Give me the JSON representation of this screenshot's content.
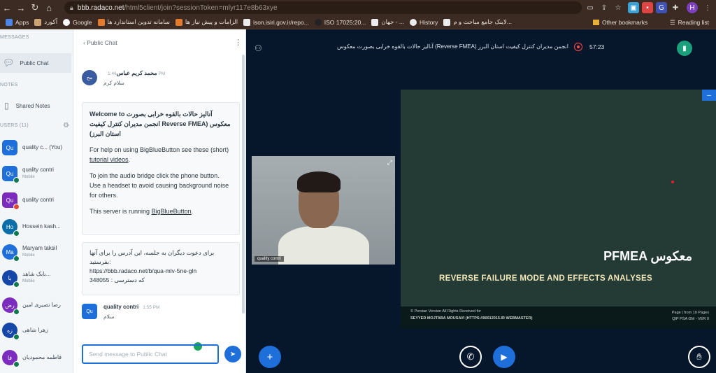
{
  "browser": {
    "url_domain": "bbb.radaco.net",
    "url_rest": "/html5client/join?sessionToken=mlyr117e8b63xye",
    "bookmarks": [
      {
        "label": "Apps",
        "color": "#4a86e8"
      },
      {
        "label": "آکورد",
        "color": "#caa472"
      },
      {
        "label": "Google",
        "color": "#ffffff"
      },
      {
        "label": "سامانه تدوین استاندارد ها",
        "color": "#e37b2e"
      },
      {
        "label": "الزامات و پیش نیاز ها",
        "color": "#e37b2e"
      },
      {
        "label": "ison.isiri.gov.ir/repo...",
        "color": "#ececec"
      },
      {
        "label": "ISO 17025:20...",
        "color": "#ececec"
      },
      {
        "label": "جهان - ...",
        "color": "#ececec"
      },
      {
        "label": "History",
        "color": "#ececec"
      },
      {
        "label": "لاینک جامع مباحث و م...",
        "color": "#ececec"
      }
    ],
    "other_bookmarks": "Other bookmarks",
    "reading_list": "Reading list",
    "profile_initial": "H"
  },
  "sidebar": {
    "messages_heading": "MESSAGES",
    "public_chat": "Public Chat",
    "notes_heading": "NOTES",
    "shared_notes": "Shared Notes",
    "users_heading": "USERS (11)",
    "users": [
      {
        "initials": "Qu",
        "name": "quality c... (You)",
        "sub": "",
        "color": "#1e6fd9",
        "shape": "square",
        "dot": false
      },
      {
        "initials": "Qu",
        "name": "quality contri",
        "sub": "Mobile",
        "color": "#1e6fd9",
        "shape": "square",
        "dot": true
      },
      {
        "initials": "Qu",
        "name": "quality contri",
        "sub": "",
        "color": "#7b2cbf",
        "shape": "square",
        "dot": true
      },
      {
        "initials": "Ho",
        "name": "Hossein kash...",
        "sub": "",
        "color": "#0b6ea8",
        "shape": "round",
        "dot": true
      },
      {
        "initials": "Ma",
        "name": "Maryam taksil",
        "sub": "Mobile",
        "color": "#1e6fd9",
        "shape": "round",
        "dot": true
      },
      {
        "initials": "با",
        "name": "بابک شاهد...",
        "sub": "Mobile",
        "color": "#1546a8",
        "shape": "round",
        "dot": true
      },
      {
        "initials": "رض",
        "name": "رضا نصیری امین",
        "sub": "",
        "color": "#7b2cbf",
        "shape": "round",
        "dot": true
      },
      {
        "initials": "زه",
        "name": "زهرا شاهی",
        "sub": "",
        "color": "#1546a8",
        "shape": "round",
        "dot": true
      },
      {
        "initials": "فا",
        "name": "فاطمه محمودیان",
        "sub": "",
        "color": "#7b2cbf",
        "shape": "round",
        "dot": true
      }
    ]
  },
  "chat": {
    "header": "Public Chat",
    "first_msg": {
      "initials": "مح",
      "name": "محمد کریم عباس",
      "time": "1:46 PM",
      "text": "سلام کرم"
    },
    "welcome": {
      "p1a": "Welcome to",
      "p1b": "آنالیز حالات بالقوه خرابی بصورت",
      "p1c": "انجمن مدیران کنترل کیفیت Reverse FMEA) معکوس",
      "p1d": "(استان البرز",
      "p2a": "For help on using BigBlueButton see these (short)",
      "p2link": "tutorial videos",
      "p3": "To join the audio bridge click the phone button. Use a headset to avoid causing background noise for others.",
      "p4a": "This server is running",
      "p4link": "BigBlueButton"
    },
    "invite": {
      "line1": "برای دعوت دیگران به جلسه، این آدرس را برای آنها بفرستید:",
      "line2": "https://bbb.radaco.net/b/qua-mlv-5ne-gln",
      "line3": "348055 : که دسترسی"
    },
    "second_msg": {
      "initials": "Qu",
      "name": "quality contri",
      "time": "1:55 PM",
      "text": "سلام"
    },
    "input_placeholder": "Send message to Public Chat"
  },
  "session": {
    "title": "آنالیز حالات بالقوه خرابی بصورت معکوس (Reverse FMEA) انجمن مدیران کنترل کیفیت استان البرز",
    "timer": "57:23"
  },
  "webcam": {
    "label": "quality contri"
  },
  "slide": {
    "title": "PFMEA معکوس",
    "subtitle": "REVERSE FAILURE MODE AND EFFECTS ANALYSES",
    "footer_l1": "© Persian Version All Rights Received for",
    "footer_l2": "SEYYED MOJTABA MOUSAVI (HTTPS://90012015.IR WEBMASTER)",
    "footer_r1": "Page | from 10 Pages",
    "footer_r2": "QIP PSA GM - VER 0"
  }
}
